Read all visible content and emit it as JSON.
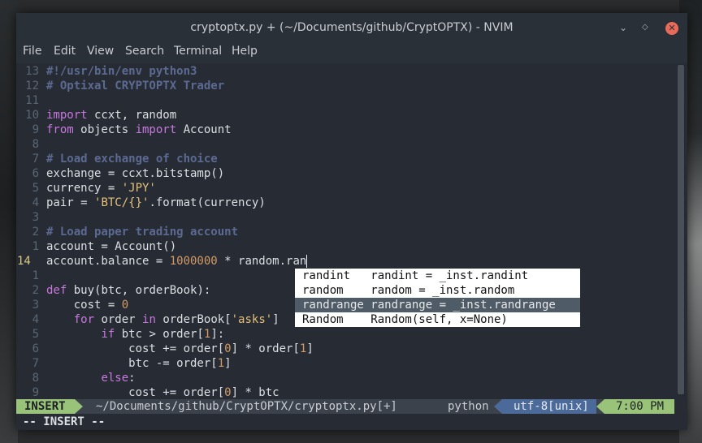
{
  "window": {
    "title": "cryptoptx.py + (~/Documents/github/CryptOPTX) - NVIM",
    "minimize_glyph": "⌄",
    "maximize_glyph": "◇",
    "close_glyph": "✕"
  },
  "menu": [
    "File",
    "Edit",
    "View",
    "Search",
    "Terminal",
    "Help"
  ],
  "editor": {
    "lines": [
      {
        "n": "13",
        "tokens": [
          {
            "t": "#!/usr/bin/env python3",
            "c": "com"
          }
        ]
      },
      {
        "n": "12",
        "tokens": [
          {
            "t": "# Optixal CRYPTOPTX Trader",
            "c": "com"
          }
        ]
      },
      {
        "n": "11",
        "tokens": []
      },
      {
        "n": "10",
        "tokens": [
          {
            "t": "import",
            "c": "kw"
          },
          {
            "t": " ccxt, random",
            "c": ""
          }
        ]
      },
      {
        "n": "9",
        "tokens": [
          {
            "t": "from",
            "c": "kw"
          },
          {
            "t": " objects ",
            "c": ""
          },
          {
            "t": "import",
            "c": "kw"
          },
          {
            "t": " Account",
            "c": ""
          }
        ]
      },
      {
        "n": "8",
        "tokens": []
      },
      {
        "n": "7",
        "tokens": [
          {
            "t": "# Load exchange of choice",
            "c": "com"
          }
        ]
      },
      {
        "n": "6",
        "tokens": [
          {
            "t": "exchange = ccxt.bitstamp()",
            "c": ""
          }
        ]
      },
      {
        "n": "5",
        "tokens": [
          {
            "t": "currency = ",
            "c": ""
          },
          {
            "t": "'JPY'",
            "c": "str"
          }
        ]
      },
      {
        "n": "4",
        "tokens": [
          {
            "t": "pair = ",
            "c": ""
          },
          {
            "t": "'BTC/{}'",
            "c": "str"
          },
          {
            "t": ".format(currency)",
            "c": ""
          }
        ]
      },
      {
        "n": "3",
        "tokens": []
      },
      {
        "n": "2",
        "tokens": [
          {
            "t": "# Load paper trading account",
            "c": "com"
          }
        ]
      },
      {
        "n": "1",
        "tokens": [
          {
            "t": "account = Account()",
            "c": ""
          }
        ]
      },
      {
        "n": "14",
        "current": true,
        "tokens": [
          {
            "t": "account.balance = ",
            "c": ""
          },
          {
            "t": "1000000",
            "c": "num"
          },
          {
            "t": " * random.ran",
            "c": ""
          }
        ]
      },
      {
        "n": "1",
        "tokens": []
      },
      {
        "n": "2",
        "tokens": [
          {
            "t": "def",
            "c": "kw"
          },
          {
            "t": " buy(btc, orderBook):",
            "c": ""
          }
        ]
      },
      {
        "n": "3",
        "tokens": [
          {
            "t": "    cost = ",
            "c": ""
          },
          {
            "t": "0",
            "c": "num"
          }
        ]
      },
      {
        "n": "4",
        "tokens": [
          {
            "t": "    ",
            "c": ""
          },
          {
            "t": "for",
            "c": "kw"
          },
          {
            "t": " order ",
            "c": ""
          },
          {
            "t": "in",
            "c": "kw"
          },
          {
            "t": " orderBook[",
            "c": ""
          },
          {
            "t": "'asks'",
            "c": "str"
          },
          {
            "t": "]",
            "c": ""
          }
        ]
      },
      {
        "n": "5",
        "tokens": [
          {
            "t": "        ",
            "c": ""
          },
          {
            "t": "if",
            "c": "kw"
          },
          {
            "t": " btc > order[",
            "c": ""
          },
          {
            "t": "1",
            "c": "num"
          },
          {
            "t": "]:",
            "c": ""
          }
        ]
      },
      {
        "n": "6",
        "tokens": [
          {
            "t": "            cost += order[",
            "c": ""
          },
          {
            "t": "0",
            "c": "num"
          },
          {
            "t": "] * order[",
            "c": ""
          },
          {
            "t": "1",
            "c": "num"
          },
          {
            "t": "]",
            "c": ""
          }
        ]
      },
      {
        "n": "7",
        "tokens": [
          {
            "t": "            btc -= order[",
            "c": ""
          },
          {
            "t": "1",
            "c": "num"
          },
          {
            "t": "]",
            "c": ""
          }
        ]
      },
      {
        "n": "8",
        "tokens": [
          {
            "t": "        ",
            "c": ""
          },
          {
            "t": "else",
            "c": "kw"
          },
          {
            "t": ":",
            "c": ""
          }
        ]
      },
      {
        "n": "9",
        "tokens": [
          {
            "t": "            cost += order[",
            "c": ""
          },
          {
            "t": "0",
            "c": "num"
          },
          {
            "t": "] * btc",
            "c": ""
          }
        ]
      }
    ]
  },
  "completion": {
    "items": [
      {
        "word": "randint  ",
        "menu": " randint = _inst.randint",
        "selected": false
      },
      {
        "word": "random   ",
        "menu": " random = _inst.random",
        "selected": false
      },
      {
        "word": "randrange",
        "menu": " randrange = _inst.randrange",
        "selected": true
      },
      {
        "word": "Random   ",
        "menu": " Random(self, x=None)",
        "selected": false
      }
    ]
  },
  "statusline": {
    "mode": "INSERT",
    "file": "~/Documents/github/CryptOPTX/cryptoptx.py[+]",
    "filetype": "python",
    "encoding": "utf-8[unix]",
    "time": "7:00 PM"
  },
  "cmdline": "-- INSERT --",
  "colors": {
    "keyword": "#c678dd",
    "string": "#e5c07b",
    "number": "#d19a66",
    "comment": "#5c6a92",
    "mode_green": "#98c379",
    "encoding_blue": "#4b6a9a"
  }
}
